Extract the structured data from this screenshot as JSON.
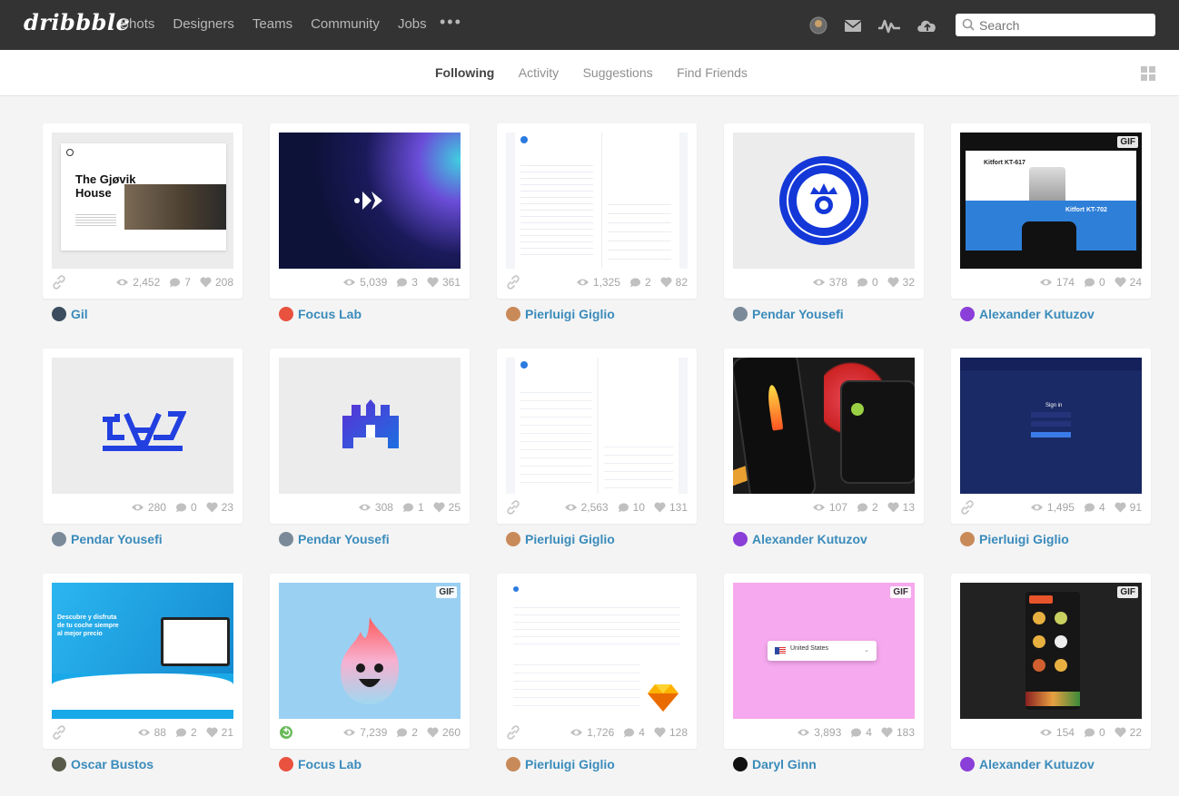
{
  "header": {
    "logo": "dribbble",
    "nav": [
      "Shots",
      "Designers",
      "Teams",
      "Community",
      "Jobs"
    ],
    "more": "•••",
    "icons": [
      "avatar-icon",
      "mail-icon",
      "activity-icon",
      "upload-icon"
    ],
    "search_placeholder": "Search"
  },
  "subnav": {
    "tabs": [
      "Following",
      "Activity",
      "Suggestions",
      "Find Friends"
    ],
    "active": "Following"
  },
  "shots": [
    {
      "views": "2,452",
      "comments": "7",
      "likes": "208",
      "author": "Gil",
      "thumb_title": "The Gjøvik House",
      "avatar_color": "#3b4d5e",
      "bg": "#ececec",
      "gif": false,
      "link": true
    },
    {
      "views": "5,039",
      "comments": "3",
      "likes": "361",
      "author": "Focus Lab",
      "avatar_color": "#e8523f",
      "bg": "#0f1540",
      "gif": false,
      "link": false
    },
    {
      "views": "1,325",
      "comments": "2",
      "likes": "82",
      "author": "Pierluigi Giglio",
      "avatar_color": "#c98a5a",
      "bg": "#f3f5f8",
      "gif": false,
      "link": true
    },
    {
      "views": "378",
      "comments": "0",
      "likes": "32",
      "author": "Pendar Yousefi",
      "avatar_color": "#7a8a99",
      "bg": "#ececec",
      "gif": false,
      "link": false
    },
    {
      "views": "174",
      "comments": "0",
      "likes": "24",
      "author": "Alexander Kutuzov",
      "avatar_color": "#8a3fd8",
      "bg": "#111111",
      "gif": true,
      "gif_label": "GIF",
      "link": false,
      "thumb_title": "Kitfort KT-617",
      "thumb_title2": "Kitfort KT-702"
    },
    {
      "views": "280",
      "comments": "0",
      "likes": "23",
      "author": "Pendar Yousefi",
      "avatar_color": "#7a8a99",
      "bg": "#ececec",
      "gif": false,
      "link": false
    },
    {
      "views": "308",
      "comments": "1",
      "likes": "25",
      "author": "Pendar Yousefi",
      "avatar_color": "#7a8a99",
      "bg": "#ececec",
      "gif": false,
      "link": false
    },
    {
      "views": "2,563",
      "comments": "10",
      "likes": "131",
      "author": "Pierluigi Giglio",
      "avatar_color": "#c98a5a",
      "bg": "#f3f5f8",
      "gif": false,
      "link": true
    },
    {
      "views": "107",
      "comments": "2",
      "likes": "13",
      "author": "Alexander Kutuzov",
      "avatar_color": "#8a3fd8",
      "bg": "#1a1a1a",
      "gif": false,
      "link": false
    },
    {
      "views": "1,495",
      "comments": "4",
      "likes": "91",
      "author": "Pierluigi Giglio",
      "avatar_color": "#c98a5a",
      "bg": "#1a2a66",
      "gif": false,
      "link": true,
      "thumb_title": "Sign in"
    },
    {
      "views": "88",
      "comments": "2",
      "likes": "21",
      "author": "Oscar Bustos",
      "avatar_color": "#5a5a4a",
      "bg": "#1aa9e8",
      "gif": false,
      "link": true,
      "thumb_title": "Descubre y disfruta de tu coche siempre al mejor precio"
    },
    {
      "views": "7,239",
      "comments": "2",
      "likes": "260",
      "author": "Focus Lab",
      "avatar_color": "#e8523f",
      "bg": "#9ad0f2",
      "gif": true,
      "gif_label": "GIF",
      "link": false,
      "rebound": true
    },
    {
      "views": "1,726",
      "comments": "4",
      "likes": "128",
      "author": "Pierluigi Giglio",
      "avatar_color": "#c98a5a",
      "bg": "#f7f8fa",
      "gif": false,
      "link": true
    },
    {
      "views": "3,893",
      "comments": "4",
      "likes": "183",
      "author": "Daryl Ginn",
      "avatar_color": "#111111",
      "bg": "#f6a9ee",
      "gif": true,
      "gif_label": "GIF",
      "link": false,
      "thumb_title": "United States"
    },
    {
      "views": "154",
      "comments": "0",
      "likes": "22",
      "author": "Alexander Kutuzov",
      "avatar_color": "#8a3fd8",
      "bg": "#222222",
      "gif": true,
      "gif_label": "GIF",
      "link": false
    }
  ]
}
